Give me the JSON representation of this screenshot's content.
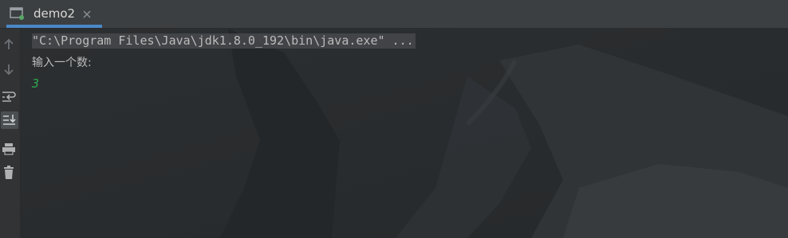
{
  "tab": {
    "label": "demo2",
    "icon": "run-console-icon",
    "close_icon": "close-icon",
    "accent": "#4a88c7"
  },
  "sidebar": {
    "buttons": [
      {
        "name": "up-arrow-icon"
      },
      {
        "name": "down-arrow-icon"
      },
      {
        "name": "soft-wrap-icon"
      },
      {
        "name": "scroll-to-end-icon",
        "active": true
      },
      {
        "name": "print-icon"
      },
      {
        "name": "trash-icon"
      }
    ]
  },
  "console": {
    "command": "\"C:\\Program Files\\Java\\jdk1.8.0_192\\bin\\java.exe\" ...",
    "prompt": "输入一个数:",
    "user_input": "3",
    "input_color": "#2fa84f"
  }
}
